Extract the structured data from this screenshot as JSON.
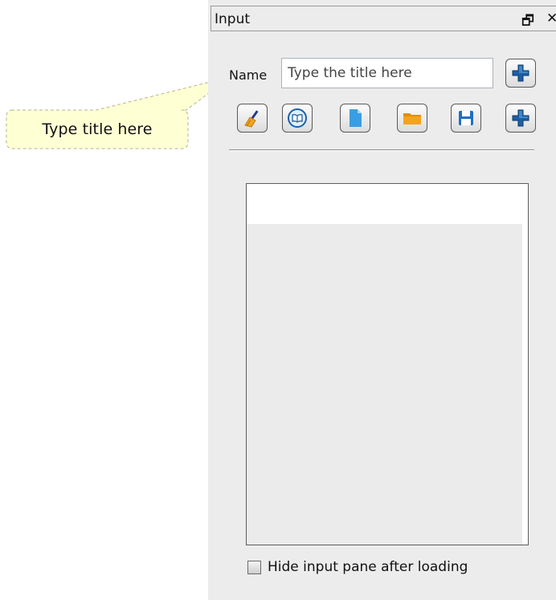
{
  "callout": {
    "text": "Type title here"
  },
  "panel": {
    "title": "Input",
    "float_glyph": "🗗",
    "close_glyph": "✕"
  },
  "name_row": {
    "label": "Name",
    "placeholder": "Type the title here",
    "value": ""
  },
  "toolbar": {
    "buttons": [
      {
        "icon": "broom-icon"
      },
      {
        "icon": "book-icon"
      },
      {
        "icon": "new-document-icon"
      },
      {
        "icon": "open-folder-icon"
      },
      {
        "icon": "save-icon"
      },
      {
        "icon": "add-icon"
      }
    ]
  },
  "list": {
    "items": []
  },
  "hide_option": {
    "label": "Hide input pane after loading",
    "checked": false
  },
  "colors": {
    "panel_bg": "#ececec",
    "callout_fill": "#ffffd4",
    "add_icon_blue": "#1c5fa6",
    "folder_orange": "#f4a31d",
    "doc_blue": "#3a9ee4"
  }
}
